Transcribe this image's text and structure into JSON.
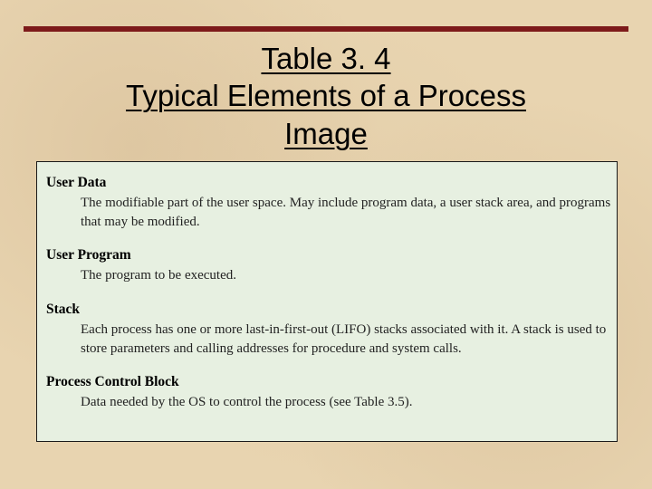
{
  "title": {
    "line1": "Table 3. 4",
    "line2": "Typical Elements of a Process",
    "line3": "Image"
  },
  "entries": [
    {
      "heading": "User Data",
      "description": "The modifiable part of the user space. May include program data, a user stack area, and programs that may be modified."
    },
    {
      "heading": "User Program",
      "description": "The program to be executed."
    },
    {
      "heading": "Stack",
      "description": "Each process has one or more last-in-first-out (LIFO) stacks associated with it. A stack is used to store parameters and calling addresses for procedure and system calls."
    },
    {
      "heading": "Process Control Block",
      "description": "Data needed by the OS to control the process (see Table 3.5)."
    }
  ]
}
